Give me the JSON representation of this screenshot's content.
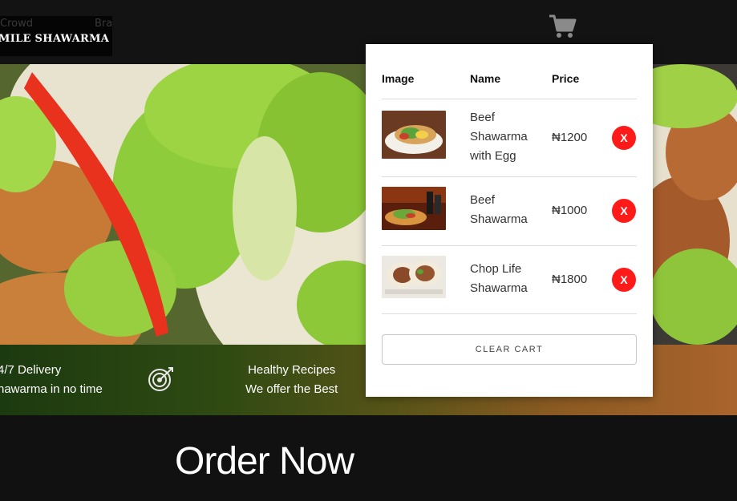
{
  "header": {
    "logo_faint_left": "Crowd",
    "logo_faint_right": "Bra",
    "logo_text": "MILE SHAWARMA",
    "cart_icon": "shopping-cart-icon"
  },
  "features": {
    "delivery_title": "4/7 Delivery",
    "delivery_sub": "hawarma in no time",
    "target_icon": "target-icon",
    "healthy_title": "Healthy Recipes",
    "healthy_sub": "We offer the Best"
  },
  "order_now": "Order Now",
  "cart": {
    "headers": {
      "image": "Image",
      "name": "Name",
      "price": "Price"
    },
    "items": [
      {
        "name": "Beef Shawarma with Egg",
        "price": "₦1200",
        "remove": "X"
      },
      {
        "name": "Beef Shawarma",
        "price": "₦1000",
        "remove": "X"
      },
      {
        "name": "Chop Life Shawarma",
        "price": "₦1800",
        "remove": "X"
      }
    ],
    "clear_label": "CLEAR CART"
  },
  "colors": {
    "remove_red": "#ff1a1a",
    "header_bg": "#131313",
    "band_green": "#2f4a12",
    "band_orange": "#a9642c"
  }
}
